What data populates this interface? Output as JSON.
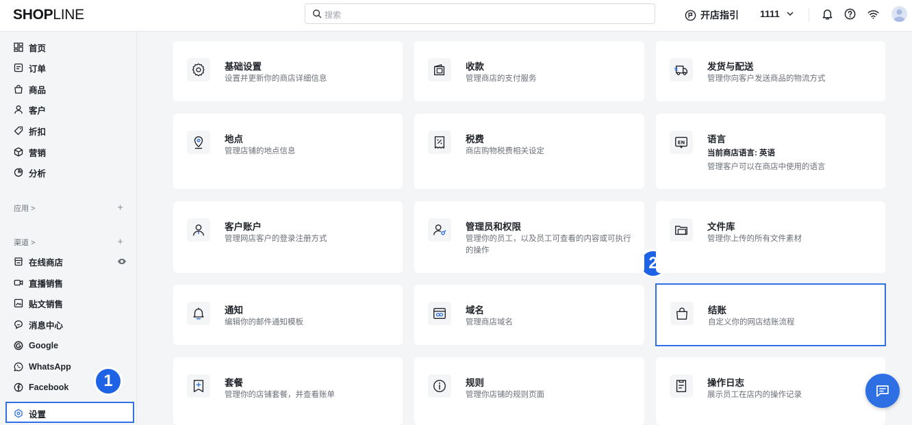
{
  "header": {
    "logo_bold": "SHOP",
    "logo_light": "LINE",
    "search_placeholder": "搜索",
    "guide_label": "开店指引",
    "store_name": "1111"
  },
  "sidebar": {
    "items": [
      {
        "label": "首页",
        "icon": "dashboard-icon"
      },
      {
        "label": "订单",
        "icon": "order-icon"
      },
      {
        "label": "商品",
        "icon": "bag-icon"
      },
      {
        "label": "客户",
        "icon": "user-icon"
      },
      {
        "label": "折扣",
        "icon": "tag-icon"
      },
      {
        "label": "营销",
        "icon": "cube-icon"
      },
      {
        "label": "分析",
        "icon": "chart-pie-icon"
      }
    ],
    "apps_label": "应用 >",
    "channels_label": "渠道 >",
    "channels": [
      {
        "label": "在线商店",
        "icon": "store-icon"
      },
      {
        "label": "直播销售",
        "icon": "video-icon"
      },
      {
        "label": "贴文销售",
        "icon": "post-icon"
      },
      {
        "label": "消息中心",
        "icon": "message-icon"
      },
      {
        "label": "Google",
        "icon": "google-icon"
      },
      {
        "label": "WhatsApp",
        "icon": "whatsapp-icon"
      },
      {
        "label": "Facebook",
        "icon": "facebook-icon"
      }
    ],
    "settings_label": "设置"
  },
  "markers": [
    "1",
    "2"
  ],
  "cards": [
    {
      "title": "基础设置",
      "desc": "设置并更新你的商店详细信息",
      "icon": "gear-icon"
    },
    {
      "title": "收款",
      "desc": "管理商店的支付服务",
      "icon": "wallet-icon"
    },
    {
      "title": "发货与配送",
      "desc": "管理你向客户发送商品的物流方式",
      "icon": "truck-icon"
    },
    {
      "title": "地点",
      "desc": "管理店铺的地点信息",
      "icon": "location-icon"
    },
    {
      "title": "税费",
      "desc": "商店购物税费相关设定",
      "icon": "tax-receipt-icon"
    },
    {
      "title": "语言",
      "extra": "当前商店语言: 英语",
      "desc": "管理客户可以在商店中使用的语言",
      "icon": "language-en-icon"
    },
    {
      "title": "客户账户",
      "desc": "管理网店客户的登录注册方式",
      "icon": "customer-account-icon"
    },
    {
      "title": "管理员和权限",
      "desc": "管理你的员工，以及员工可查看的内容或可执行的操作",
      "icon": "admin-permission-icon"
    },
    {
      "title": "文件库",
      "desc": "管理你上传的所有文件素材",
      "icon": "folder-icon"
    },
    {
      "title": "通知",
      "desc": "编辑你的邮件通知模板",
      "icon": "bell-icon"
    },
    {
      "title": "域名",
      "desc": "管理商店域名",
      "icon": "domain-link-icon"
    },
    {
      "title": "结账",
      "desc": "自定义你的网店结账流程",
      "icon": "checkout-bag-icon"
    },
    {
      "title": "套餐",
      "desc": "管理你的店铺套餐，并查看账单",
      "icon": "plan-icon"
    },
    {
      "title": "规则",
      "desc": "管理你店铺的规则页面",
      "icon": "info-icon"
    },
    {
      "title": "操作日志",
      "desc": "展示员工在店内的操作记录",
      "icon": "log-icon"
    }
  ],
  "colors": {
    "accent": "#2f6fe4",
    "marker": "#1e63e6"
  }
}
